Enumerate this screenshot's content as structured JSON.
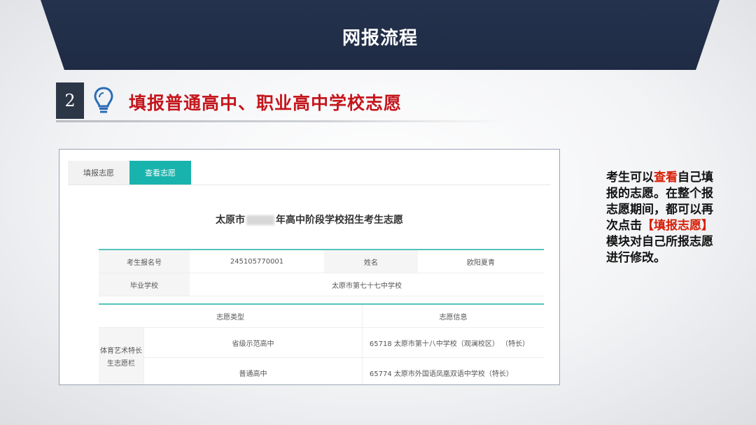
{
  "banner": {
    "title": "网报流程"
  },
  "step": {
    "number": "2",
    "title": "填报普通高中、职业高中学校志愿"
  },
  "panel": {
    "tabs": [
      {
        "label": "填报志愿",
        "active": false
      },
      {
        "label": "查看志愿",
        "active": true
      }
    ],
    "form_title_prefix": "太原市",
    "form_title_suffix": "年高中阶段学校招生考生志愿",
    "info": {
      "id_label": "考生报名号",
      "id_value": "245105770001",
      "name_label": "姓名",
      "name_value": "欧阳夏青",
      "school_label": "毕业学校",
      "school_value": "太原市第七十七中学校"
    },
    "choices": {
      "col_type": "志愿类型",
      "col_info": "志愿信息",
      "category": "体育艺术特长生志愿栏",
      "rows": [
        {
          "type": "省级示范高中",
          "info": "65718 太原市第十八中学校（观澜校区） （特长）"
        },
        {
          "type": "普通高中",
          "info": "65774 太原市外国语凤凰双语中学校（特长）"
        }
      ]
    }
  },
  "note": {
    "part1": "考生可以",
    "highlight1": "查看",
    "part2": "自己填报的志愿。在整个报志愿期间，都可以再次点击",
    "highlight2": "【填报志愿】",
    "part3": "模块对自己所报志愿进行修改。"
  },
  "colors": {
    "banner": "#1f2b44",
    "accent_red": "#c4161c",
    "tab_active": "#19b3ad"
  },
  "icons": {
    "step_icon": "lightbulb-icon"
  }
}
